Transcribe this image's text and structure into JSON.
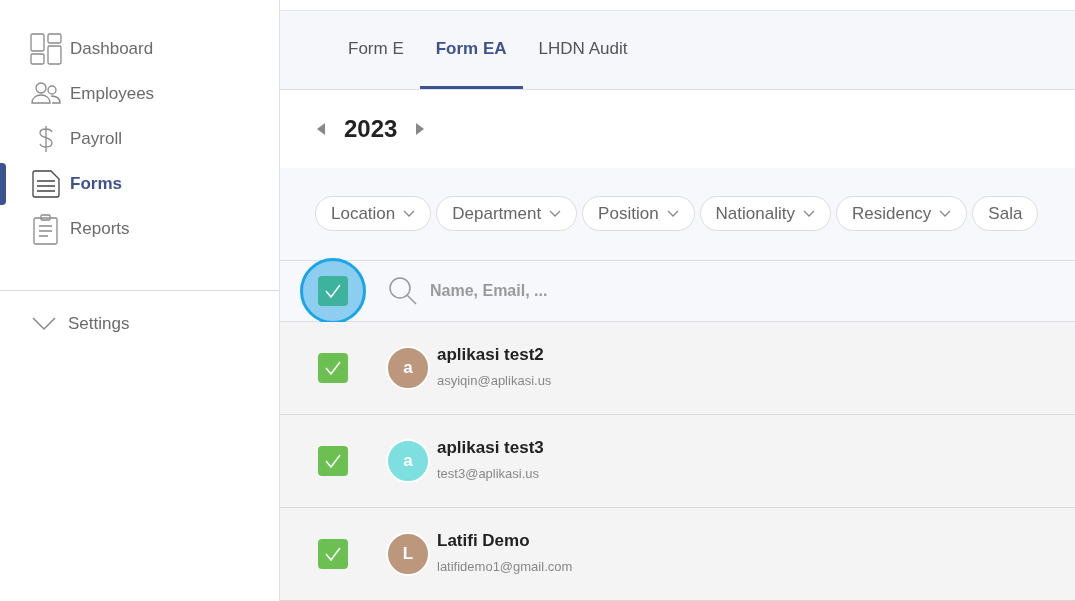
{
  "sidebar": {
    "items": [
      {
        "label": "Dashboard",
        "kind": "dashboard",
        "selected": false
      },
      {
        "label": "Employees",
        "kind": "employees",
        "selected": false
      },
      {
        "label": "Payroll",
        "kind": "payroll",
        "selected": false
      },
      {
        "label": "Forms",
        "kind": "forms",
        "selected": true
      },
      {
        "label": "Reports",
        "kind": "reports",
        "selected": false
      }
    ],
    "settings": {
      "label": "Settings",
      "expanded": false
    }
  },
  "tabs": [
    {
      "label": "Form E",
      "selected": false
    },
    {
      "label": "Form EA",
      "selected": true
    },
    {
      "label": "LHDN Audit",
      "selected": false
    }
  ],
  "year": "2023",
  "filters": [
    "Location",
    "Department",
    "Position",
    "Nationality",
    "Residency",
    "Sala"
  ],
  "select_all": {
    "checked": true
  },
  "search": {
    "placeholder": "Name, Email, ..."
  },
  "employees": [
    {
      "checked": true,
      "initial": "a",
      "color": "#bd977c",
      "name": "aplikasi test2",
      "email": "asyiqin@aplikasi.us"
    },
    {
      "checked": true,
      "initial": "a",
      "color": "#7ddfdf",
      "name": "aplikasi test3",
      "email": "test3@aplikasi.us"
    },
    {
      "checked": true,
      "initial": "L",
      "color": "#bd977c",
      "name": "Latifi Demo",
      "email": "latifidemo1@gmail.com"
    }
  ]
}
